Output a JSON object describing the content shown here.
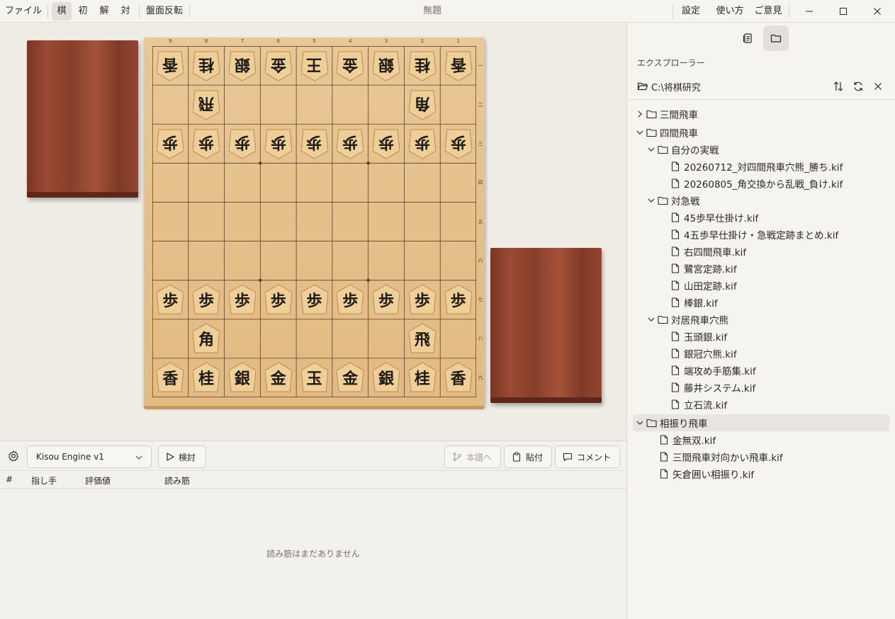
{
  "titlebar": {
    "menu_file": "ファイル",
    "mode_tabs": [
      "棋",
      "初",
      "解",
      "対"
    ],
    "flip_board": "盤面反転",
    "title": "無題",
    "settings": "設定",
    "help": "使い方",
    "feedback": "ご意見"
  },
  "board": {
    "file_labels": [
      "9",
      "8",
      "7",
      "6",
      "5",
      "4",
      "3",
      "2",
      "1"
    ],
    "rank_labels": [
      "一",
      "二",
      "三",
      "四",
      "五",
      "六",
      "七",
      "八",
      "九"
    ],
    "pieces": [
      {
        "file": 9,
        "rank": 1,
        "char": "香",
        "side": "gote"
      },
      {
        "file": 8,
        "rank": 1,
        "char": "桂",
        "side": "gote"
      },
      {
        "file": 7,
        "rank": 1,
        "char": "銀",
        "side": "gote"
      },
      {
        "file": 6,
        "rank": 1,
        "char": "金",
        "side": "gote"
      },
      {
        "file": 5,
        "rank": 1,
        "char": "王",
        "side": "gote"
      },
      {
        "file": 4,
        "rank": 1,
        "char": "金",
        "side": "gote"
      },
      {
        "file": 3,
        "rank": 1,
        "char": "銀",
        "side": "gote"
      },
      {
        "file": 2,
        "rank": 1,
        "char": "桂",
        "side": "gote"
      },
      {
        "file": 1,
        "rank": 1,
        "char": "香",
        "side": "gote"
      },
      {
        "file": 8,
        "rank": 2,
        "char": "飛",
        "side": "gote"
      },
      {
        "file": 2,
        "rank": 2,
        "char": "角",
        "side": "gote"
      },
      {
        "file": 9,
        "rank": 3,
        "char": "歩",
        "side": "gote"
      },
      {
        "file": 8,
        "rank": 3,
        "char": "歩",
        "side": "gote"
      },
      {
        "file": 7,
        "rank": 3,
        "char": "歩",
        "side": "gote"
      },
      {
        "file": 6,
        "rank": 3,
        "char": "歩",
        "side": "gote"
      },
      {
        "file": 5,
        "rank": 3,
        "char": "歩",
        "side": "gote"
      },
      {
        "file": 4,
        "rank": 3,
        "char": "歩",
        "side": "gote"
      },
      {
        "file": 3,
        "rank": 3,
        "char": "歩",
        "side": "gote"
      },
      {
        "file": 2,
        "rank": 3,
        "char": "歩",
        "side": "gote"
      },
      {
        "file": 1,
        "rank": 3,
        "char": "歩",
        "side": "gote"
      },
      {
        "file": 9,
        "rank": 7,
        "char": "歩",
        "side": "sente"
      },
      {
        "file": 8,
        "rank": 7,
        "char": "歩",
        "side": "sente"
      },
      {
        "file": 7,
        "rank": 7,
        "char": "歩",
        "side": "sente"
      },
      {
        "file": 6,
        "rank": 7,
        "char": "歩",
        "side": "sente"
      },
      {
        "file": 5,
        "rank": 7,
        "char": "歩",
        "side": "sente"
      },
      {
        "file": 4,
        "rank": 7,
        "char": "歩",
        "side": "sente"
      },
      {
        "file": 3,
        "rank": 7,
        "char": "歩",
        "side": "sente"
      },
      {
        "file": 2,
        "rank": 7,
        "char": "歩",
        "side": "sente"
      },
      {
        "file": 1,
        "rank": 7,
        "char": "歩",
        "side": "sente"
      },
      {
        "file": 8,
        "rank": 8,
        "char": "角",
        "side": "sente"
      },
      {
        "file": 2,
        "rank": 8,
        "char": "飛",
        "side": "sente"
      },
      {
        "file": 9,
        "rank": 9,
        "char": "香",
        "side": "sente"
      },
      {
        "file": 8,
        "rank": 9,
        "char": "桂",
        "side": "sente"
      },
      {
        "file": 7,
        "rank": 9,
        "char": "銀",
        "side": "sente"
      },
      {
        "file": 6,
        "rank": 9,
        "char": "金",
        "side": "sente"
      },
      {
        "file": 5,
        "rank": 9,
        "char": "玉",
        "side": "sente"
      },
      {
        "file": 4,
        "rank": 9,
        "char": "金",
        "side": "sente"
      },
      {
        "file": 3,
        "rank": 9,
        "char": "銀",
        "side": "sente"
      },
      {
        "file": 2,
        "rank": 9,
        "char": "桂",
        "side": "sente"
      },
      {
        "file": 1,
        "rank": 9,
        "char": "香",
        "side": "sente"
      }
    ]
  },
  "engine": {
    "selected": "Kisou Engine v1",
    "analyze": "検討",
    "to_main": "本譜へ",
    "paste": "貼付",
    "comment": "コメント"
  },
  "analysis": {
    "columns": [
      "#",
      "指し手",
      "評価値",
      "読み筋"
    ],
    "empty": "読み筋はまだありません"
  },
  "explorer": {
    "title": "エクスプローラー",
    "path": "C:\\将棋研究",
    "tree": [
      {
        "type": "folder",
        "depth": 0,
        "expanded": false,
        "name": "三間飛車"
      },
      {
        "type": "folder",
        "depth": 0,
        "expanded": true,
        "name": "四間飛車"
      },
      {
        "type": "folder",
        "depth": 1,
        "expanded": true,
        "name": "自分の実戦"
      },
      {
        "type": "file",
        "depth": 2,
        "name": "20260712_対四間飛車穴熊_勝ち.kif"
      },
      {
        "type": "file",
        "depth": 2,
        "name": "20260805_角交換から乱戦_負け.kif"
      },
      {
        "type": "folder",
        "depth": 1,
        "expanded": true,
        "name": "対急戦"
      },
      {
        "type": "file",
        "depth": 2,
        "name": "45歩早仕掛け.kif"
      },
      {
        "type": "file",
        "depth": 2,
        "name": "4五歩早仕掛け・急戦定跡まとめ.kif"
      },
      {
        "type": "file",
        "depth": 2,
        "name": "右四間飛車.kif"
      },
      {
        "type": "file",
        "depth": 2,
        "name": "鷺宮定跡.kif"
      },
      {
        "type": "file",
        "depth": 2,
        "name": "山田定跡.kif"
      },
      {
        "type": "file",
        "depth": 2,
        "name": "棒銀.kif"
      },
      {
        "type": "folder",
        "depth": 1,
        "expanded": true,
        "name": "対居飛車穴熊"
      },
      {
        "type": "file",
        "depth": 2,
        "name": "玉頭銀.kif"
      },
      {
        "type": "file",
        "depth": 2,
        "name": "銀冠穴熊.kif"
      },
      {
        "type": "file",
        "depth": 2,
        "name": "端攻め手筋集.kif"
      },
      {
        "type": "file",
        "depth": 2,
        "name": "藤井システム.kif"
      },
      {
        "type": "file",
        "depth": 2,
        "name": "立石流.kif"
      },
      {
        "type": "folder",
        "depth": 0,
        "expanded": true,
        "name": "相振り飛車",
        "selected": true
      },
      {
        "type": "file",
        "depth": 1,
        "name": "金無双.kif"
      },
      {
        "type": "file",
        "depth": 1,
        "name": "三間飛車対向かい飛車.kif"
      },
      {
        "type": "file",
        "depth": 1,
        "name": "矢倉囲い相振り.kif"
      }
    ]
  }
}
